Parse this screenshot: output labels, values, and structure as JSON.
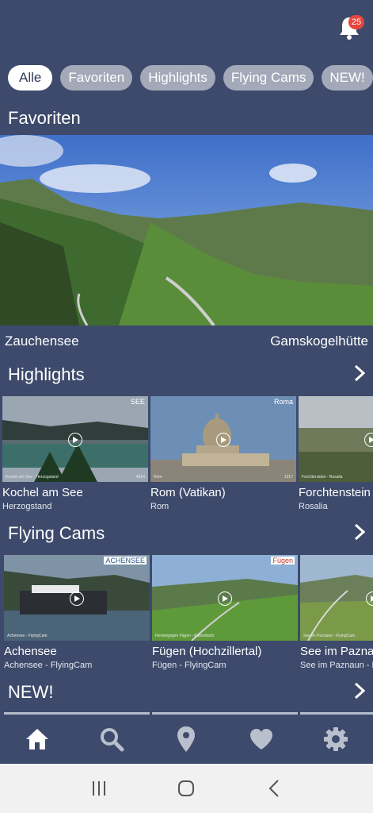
{
  "header": {
    "notification_count": "25",
    "bell_icon": "bell-icon"
  },
  "filters": [
    {
      "label": "Alle",
      "active": true
    },
    {
      "label": "Favoriten",
      "active": false
    },
    {
      "label": "Highlights",
      "active": false
    },
    {
      "label": "Flying Cams",
      "active": false
    },
    {
      "label": "NEW!",
      "active": false
    }
  ],
  "favoriten": {
    "title": "Favoriten",
    "hero": {
      "location": "Zauchensee",
      "camera": "Gamskogelhütte"
    }
  },
  "highlights": {
    "title": "Highlights",
    "cards": [
      {
        "title": "Kochel am See",
        "subtitle": "Herzogstand",
        "overlay_left": "Kochel am See - Herzogstand",
        "overlay_right": "4524",
        "tag": "SEE"
      },
      {
        "title": "Rom (Vatikan)",
        "subtitle": "Rom",
        "overlay_left": "Rom",
        "overlay_right": "1017",
        "tag": "Roma"
      },
      {
        "title": "Forchtenstein",
        "subtitle": "Rosalia",
        "overlay_left": "Forchtenstein - Rosalia",
        "overlay_right": "",
        "tag": ""
      }
    ]
  },
  "flying_cams": {
    "title": "Flying Cams",
    "cards": [
      {
        "title": "Achensee",
        "subtitle": "Achensee - FlyingCam",
        "overlay_left": "Achensee - FlyingCam",
        "tag": "ACHENSEE"
      },
      {
        "title": "Fügen (Hochzillertal)",
        "subtitle": "Fügen - FlyingCam",
        "overlay_left": "Fleriengegen Fügen - Kaltenbach",
        "tag": "Fügen"
      },
      {
        "title": "See im Paznaun",
        "subtitle": "See im Paznaun - FlyingCam",
        "overlay_left": "See im Paznaun - FlyingCam",
        "tag": ""
      }
    ]
  },
  "new_section": {
    "title": "NEW!"
  },
  "bottom_nav": [
    {
      "icon": "home-icon",
      "active": true
    },
    {
      "icon": "search-icon",
      "active": false
    },
    {
      "icon": "map-pin-icon",
      "active": false
    },
    {
      "icon": "heart-icon",
      "active": false
    },
    {
      "icon": "gear-icon",
      "active": false
    }
  ],
  "system_nav": [
    {
      "icon": "recent-apps-icon"
    },
    {
      "icon": "home-circle-icon"
    },
    {
      "icon": "back-icon"
    }
  ],
  "colors": {
    "background": "#3d4a6b",
    "chip_inactive": "#a3a9b8",
    "chip_active": "#ffffff",
    "badge": "#e8453c"
  }
}
